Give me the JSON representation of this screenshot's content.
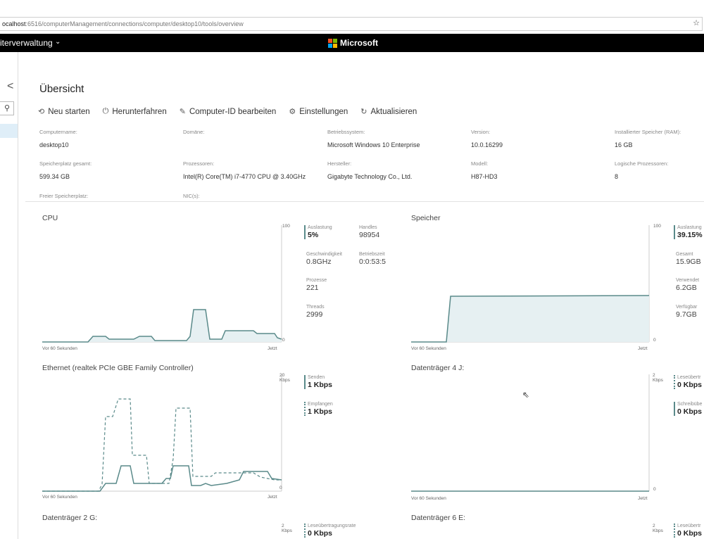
{
  "browser": {
    "url_host": "ocalhost",
    "url_rest": ":6516/computerManagement/connections/computer/desktop10/tools/overview"
  },
  "appbar": {
    "app_name": "iterverwaltung",
    "brand": "Microsoft",
    "logo_colors": [
      "#f25022",
      "#7fba00",
      "#00a4ef",
      "#ffb900"
    ]
  },
  "page": {
    "title": "Übersicht"
  },
  "toolbar": {
    "restart": "Neu starten",
    "shutdown": "Herunterfahren",
    "edit_id": "Computer-ID bearbeiten",
    "settings": "Einstellungen",
    "refresh": "Aktualisieren"
  },
  "properties": [
    {
      "label": "Computername:",
      "value": "desktop10"
    },
    {
      "label": "Domäne:",
      "value": ""
    },
    {
      "label": "Betriebssystem:",
      "value": "Microsoft Windows 10 Enterprise"
    },
    {
      "label": "Version:",
      "value": "10.0.16299"
    },
    {
      "label": "Installierter Speicher (RAM):",
      "value": "16 GB"
    },
    {
      "label": "Speicherplatz gesamt:",
      "value": "599.34 GB"
    },
    {
      "label": "Prozessoren:",
      "value": "Intel(R) Core(TM) i7-4770 CPU @ 3.40GHz"
    },
    {
      "label": "Hersteller:",
      "value": "Gigabyte Technology Co., Ltd."
    },
    {
      "label": "Modell:",
      "value": "H87-HD3"
    },
    {
      "label": "Logische Prozessoren:",
      "value": "8"
    },
    {
      "label": "Freier Speicherplatz:",
      "value": ""
    },
    {
      "label": "NIC(s):",
      "value": ""
    }
  ],
  "cpu": {
    "title": "CPU",
    "ymax": "100",
    "ymin": "0",
    "x_start": "Vor 60 Sekunden",
    "x_end": "Jetzt",
    "stats": {
      "usage_label": "Auslastung",
      "usage": "5%",
      "handles_label": "Handles",
      "handles": "98954",
      "speed_label": "Geschwindigkeit",
      "speed": "0.8GHz",
      "uptime_label": "Betriebszeit",
      "uptime": "0:0:53:5",
      "processes_label": "Prozesse",
      "processes": "221",
      "threads_label": "Threads",
      "threads": "2999"
    }
  },
  "memory": {
    "title": "Speicher",
    "ymax": "100",
    "ymin": "0",
    "x_start": "Vor 60 Sekunden",
    "x_end": "Jetzt",
    "stats": {
      "usage_label": "Auslastung",
      "usage": "39.15%",
      "total_label": "Gesamt",
      "total": "15.9GB",
      "used_label": "Verwendet",
      "used": "6.2GB",
      "avail_label": "Verfügbar",
      "avail": "9.7GB"
    }
  },
  "ethernet": {
    "title": "Ethernet (realtek PCIe GBE Family Controller)",
    "ymax": "20",
    "yunit": "Kbps",
    "ymin": "0",
    "x_start": "Vor 60 Sekunden",
    "x_end": "Jetzt",
    "stats": {
      "send_label": "Senden",
      "send": "1 Kbps",
      "recv_label": "Empfangen",
      "recv": "1 Kbps"
    }
  },
  "disk4": {
    "title": "Datenträger 4 J:",
    "ymax": "2",
    "yunit": "Kbps",
    "ymin": "0",
    "x_start": "Vor 60 Sekunden",
    "x_end": "Jetzt",
    "stats": {
      "read_label": "Leseübertr",
      "read": "0 Kbps",
      "write_label": "Schreibübe",
      "write": "0 Kbps"
    }
  },
  "disk2": {
    "title": "Datenträger 2 G:",
    "ymax": "2",
    "yunit": "Kbps",
    "stats": {
      "read_label": "Leseübertragungsrate",
      "read": "0 Kbps"
    }
  },
  "disk6": {
    "title": "Datenträger 6 E:",
    "ymax": "2",
    "yunit": "Kbps",
    "stats": {
      "read_label": "Leseübertr",
      "read": "0 Kbps"
    }
  },
  "colors": {
    "line": "#5a8a8a",
    "fill": "#e6f0f2",
    "accent": "#dfeef8"
  }
}
